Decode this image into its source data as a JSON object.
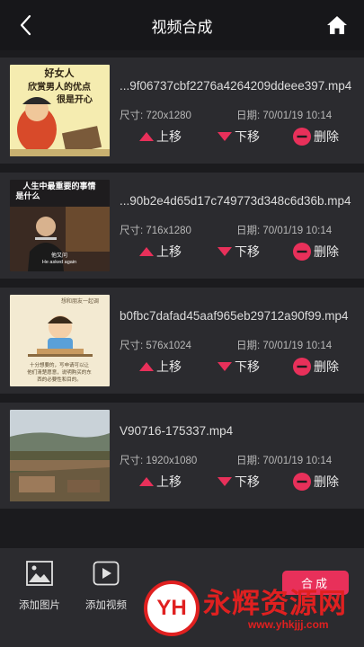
{
  "header": {
    "title": "视频合成",
    "back_icon": "back-arrow-icon",
    "home_icon": "home-icon"
  },
  "videos": [
    {
      "filename": "...9f06737cbf2276a4264209ddeee397.mp4",
      "size": "尺寸: 720x1280",
      "date": "日期: 70/01/19 10:14",
      "thumb_lines": [
        "好女人",
        "欣赏男人的优点",
        "很是开心"
      ]
    },
    {
      "filename": "...90b2e4d65d17c749773d348c6d36b.mp4",
      "size": "尺寸: 716x1280",
      "date": "日期: 70/01/19 10:14",
      "thumb_lines": [
        "人生中最重要的事情",
        "是什么",
        "他又问",
        "He asked again"
      ]
    },
    {
      "filename": "b0fbc7dafad45aaf965eb29712a90f99.mp4",
      "size": "尺寸: 576x1024",
      "date": "日期: 70/01/19 10:14",
      "thumb_lines": [
        "想和朋友一起调",
        "十分想要的，写申请可以让",
        "他们清楚愿意，说明购买的东",
        "西的必要性和目的。"
      ]
    },
    {
      "filename": "V90716-175337.mp4",
      "size": "尺寸: 1920x1080",
      "date": "日期: 70/01/19 10:14",
      "thumb_lines": []
    }
  ],
  "actions": {
    "up": "上移",
    "down": "下移",
    "delete": "删除"
  },
  "bottom": {
    "add_image": "添加图片",
    "add_video": "添加视频",
    "compose": "合成"
  },
  "watermark": {
    "logo": "YH",
    "text": "永辉资源网",
    "url": "www.yhkjjj.com"
  },
  "colors": {
    "accent": "#e8305a",
    "background": "#1b1b1e",
    "card": "#2b2b2f"
  }
}
